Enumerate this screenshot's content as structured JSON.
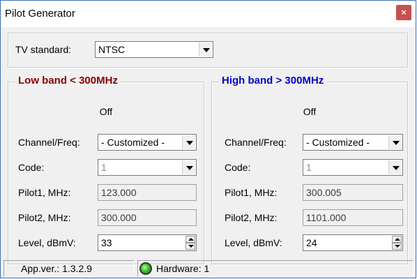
{
  "window": {
    "title": "Pilot Generator",
    "close_glyph": "×"
  },
  "tv": {
    "label": "TV standard:",
    "value": "NTSC"
  },
  "low_band": {
    "title": "Low band < 300MHz",
    "title_color": "#8b0000",
    "status": "Off",
    "channel_label": "Channel/Freq:",
    "channel_value": "- Customized -",
    "code_label": "Code:",
    "code_value": "1",
    "pilot1_label": "Pilot1, MHz:",
    "pilot1_value": "123.000",
    "pilot2_label": "Pilot2, MHz:",
    "pilot2_value": "300.000",
    "level_label": "Level, dBmV:",
    "level_value": "33"
  },
  "high_band": {
    "title": "High band > 300MHz",
    "title_color": "#0000cc",
    "status": "Off",
    "channel_label": "Channel/Freq:",
    "channel_value": "- Customized -",
    "code_label": "Code:",
    "code_value": "1",
    "pilot1_label": "Pilot1, MHz:",
    "pilot1_value": "300.005",
    "pilot2_label": "Pilot2, MHz:",
    "pilot2_value": "1101.000",
    "level_label": "Level, dBmV:",
    "level_value": "24"
  },
  "statusbar": {
    "app_version": "App.ver.: 1.3.2.9",
    "hardware": "Hardware: 1",
    "hardware_led_color": "#37c426"
  }
}
